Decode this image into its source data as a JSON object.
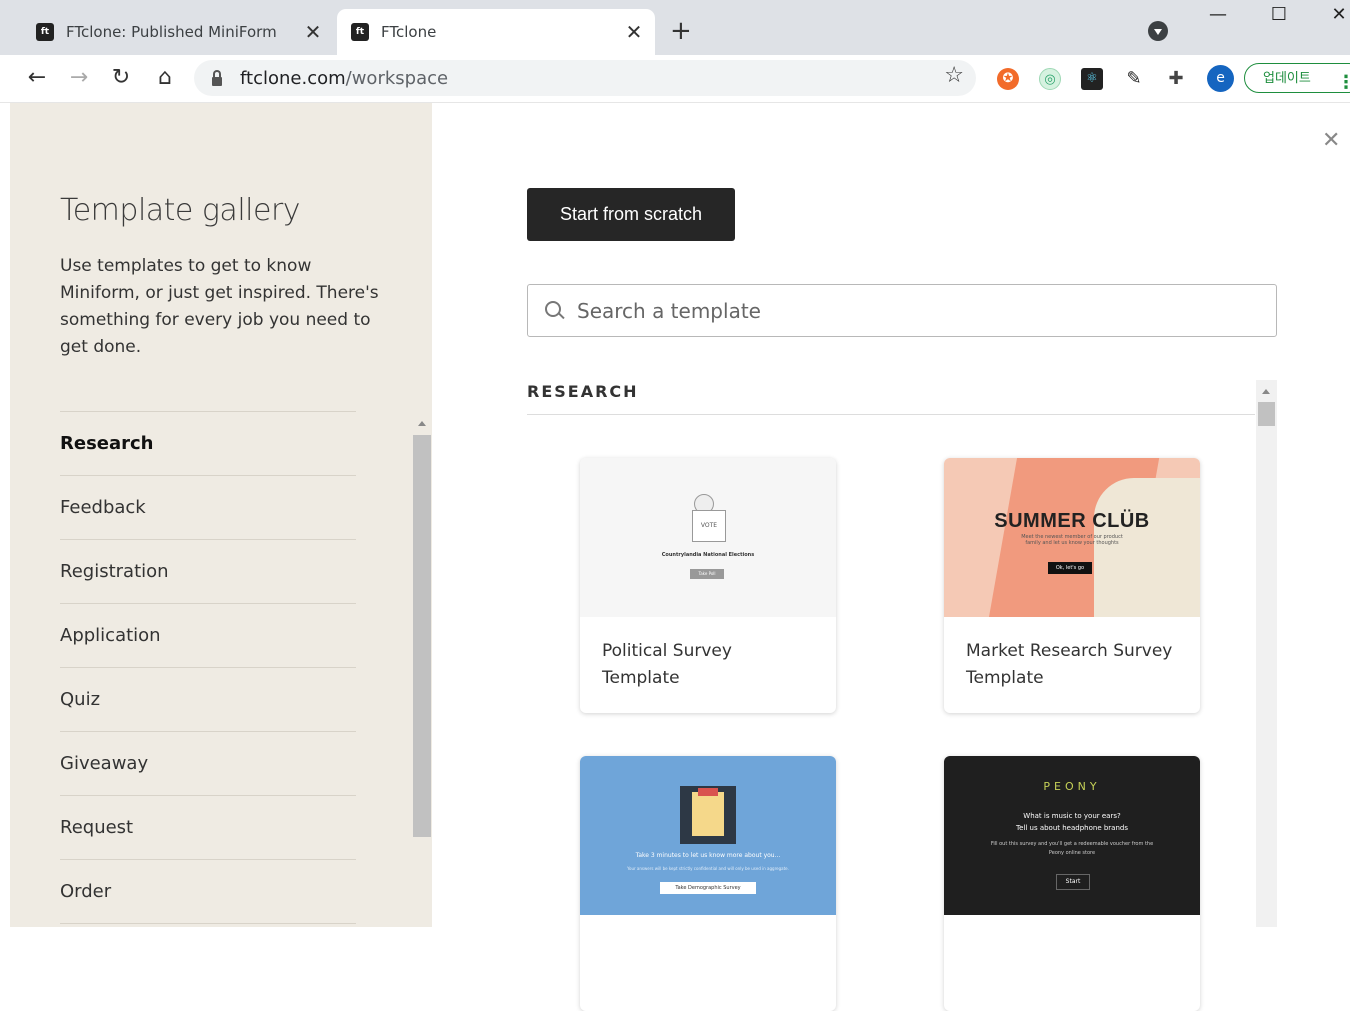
{
  "browser": {
    "tabs": [
      {
        "title": "FTclone: Published MiniForm",
        "favicon": "ft"
      },
      {
        "title": "FTclone",
        "favicon": "ft"
      }
    ],
    "url_host": "ftclone.com",
    "url_path": "/workspace",
    "avatar_letter": "e",
    "update_label": "업데이트"
  },
  "sidebar": {
    "title": "Template gallery",
    "description": "Use templates to get to know Miniform, or just get inspired. There's something for every job you need to get done.",
    "categories": [
      "Research",
      "Feedback",
      "Registration",
      "Application",
      "Quiz",
      "Giveaway",
      "Request",
      "Order"
    ],
    "active_category": "Research"
  },
  "main": {
    "start_button": "Start from scratch",
    "search_placeholder": "Search a template",
    "section_heading": "RESEARCH",
    "cards": [
      {
        "label": "Political Survey Template",
        "thumb": {
          "box_text": "VOTE",
          "title": "Countrylandia National Elections",
          "button": "Take Poll"
        }
      },
      {
        "label": "Market Research Survey Template",
        "thumb": {
          "heading": "SUMMER CLÜB",
          "subtitle": "Meet the newest member of our product family and let us know your thoughts",
          "button": "Ok, let's go"
        }
      },
      {
        "label": "",
        "thumb": {
          "text": "Take 3 minutes to let us know more about you...",
          "subtitle": "Your answers will be kept strictly confidential and will only be used in aggregate.",
          "button": "Take Demographic Survey"
        }
      },
      {
        "label": "",
        "thumb": {
          "brand": "PEONY",
          "question_1": "What is music to your ears?",
          "question_2": "Tell us about headphone brands",
          "subtitle": "Fill out this survey and you'll get a redeemable voucher from the Peony online store",
          "button": "Start"
        }
      }
    ]
  },
  "colors": {
    "sidebar_bg": "#efebe3",
    "primary_button": "#262626",
    "update_green": "#1e8e3e"
  }
}
